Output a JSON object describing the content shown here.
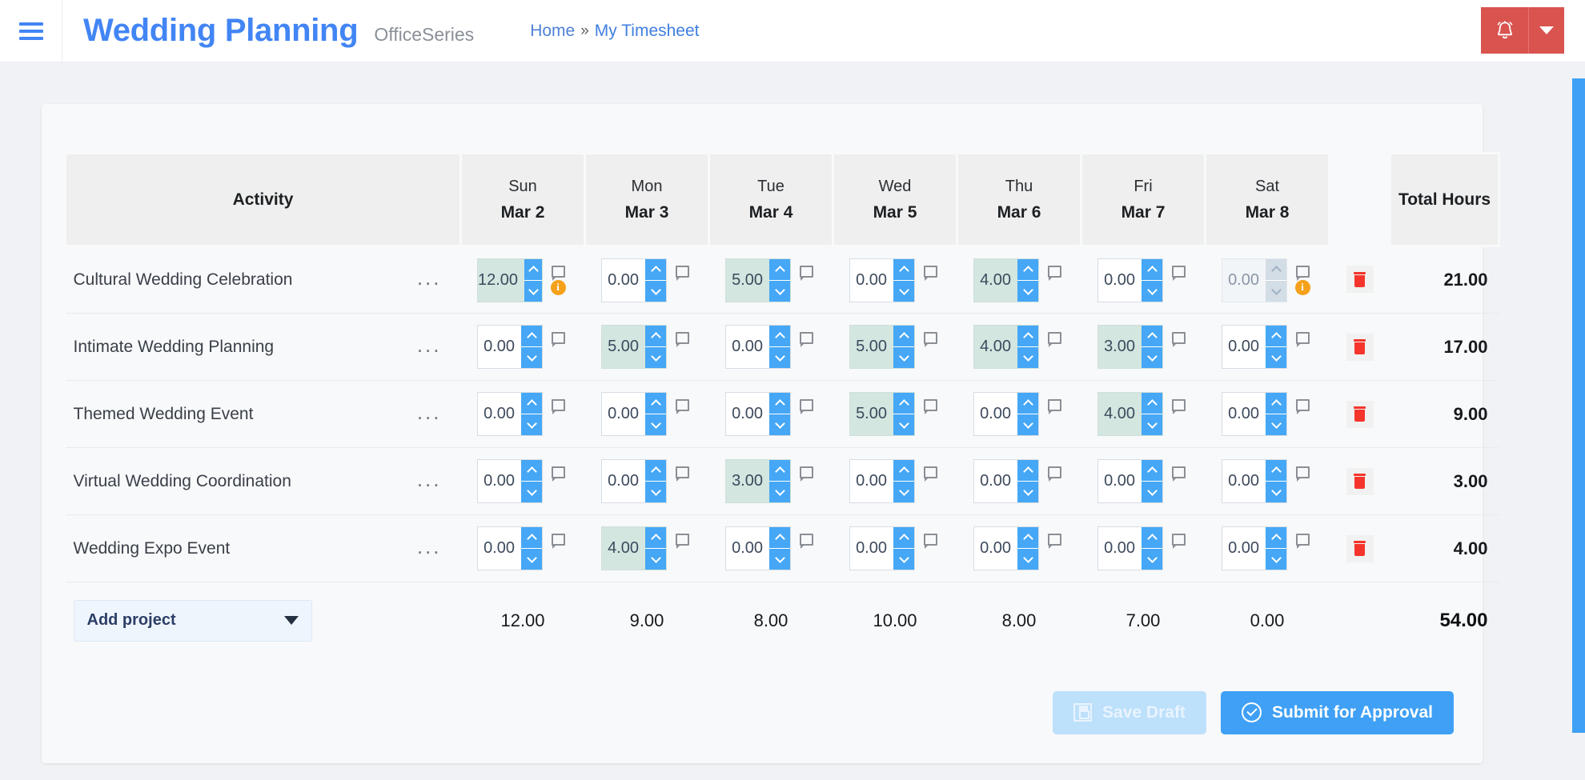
{
  "topbar": {
    "menu_icon": "hamburger-icon",
    "brand_title": "Wedding Planning",
    "brand_subtitle": "OfficeSeries",
    "breadcrumb": {
      "home": "Home",
      "separator": "»",
      "current": "My Timesheet"
    },
    "alert_icon": "bell-icon",
    "alert_caret_icon": "chevron-down-icon",
    "alert_color": "#d9534f"
  },
  "timesheet": {
    "columns": {
      "activity": "Activity",
      "days": [
        {
          "dow": "Sun",
          "date": "Mar 2"
        },
        {
          "dow": "Mon",
          "date": "Mar 3"
        },
        {
          "dow": "Tue",
          "date": "Mar 4"
        },
        {
          "dow": "Wed",
          "date": "Mar 5"
        },
        {
          "dow": "Thu",
          "date": "Mar 6"
        },
        {
          "dow": "Fri",
          "date": "Mar 7"
        },
        {
          "dow": "Sat",
          "date": "Mar 8"
        }
      ],
      "total": "Total Hours"
    },
    "row_menu_label": "...",
    "rows": [
      {
        "activity": "Cultural Wedding Celebration",
        "hours": [
          "12.00",
          "0.00",
          "5.00",
          "0.00",
          "4.00",
          "0.00",
          "0.00"
        ],
        "filled": [
          true,
          false,
          true,
          false,
          true,
          false,
          false
        ],
        "disabled": [
          false,
          false,
          false,
          false,
          false,
          false,
          true
        ],
        "info": [
          true,
          false,
          false,
          false,
          false,
          false,
          true
        ],
        "total": "21.00"
      },
      {
        "activity": "Intimate Wedding Planning",
        "hours": [
          "0.00",
          "5.00",
          "0.00",
          "5.00",
          "4.00",
          "3.00",
          "0.00"
        ],
        "filled": [
          false,
          true,
          false,
          true,
          true,
          true,
          false
        ],
        "disabled": [
          false,
          false,
          false,
          false,
          false,
          false,
          false
        ],
        "info": [
          false,
          false,
          false,
          false,
          false,
          false,
          false
        ],
        "total": "17.00"
      },
      {
        "activity": "Themed Wedding Event",
        "hours": [
          "0.00",
          "0.00",
          "0.00",
          "5.00",
          "0.00",
          "4.00",
          "0.00"
        ],
        "filled": [
          false,
          false,
          false,
          true,
          false,
          true,
          false
        ],
        "disabled": [
          false,
          false,
          false,
          false,
          false,
          false,
          false
        ],
        "info": [
          false,
          false,
          false,
          false,
          false,
          false,
          false
        ],
        "total": "9.00"
      },
      {
        "activity": "Virtual Wedding Coordination",
        "hours": [
          "0.00",
          "0.00",
          "3.00",
          "0.00",
          "0.00",
          "0.00",
          "0.00"
        ],
        "filled": [
          false,
          false,
          true,
          false,
          false,
          false,
          false
        ],
        "disabled": [
          false,
          false,
          false,
          false,
          false,
          false,
          false
        ],
        "info": [
          false,
          false,
          false,
          false,
          false,
          false,
          false
        ],
        "total": "3.00"
      },
      {
        "activity": "Wedding Expo Event",
        "hours": [
          "0.00",
          "4.00",
          "0.00",
          "0.00",
          "0.00",
          "0.00",
          "0.00"
        ],
        "filled": [
          false,
          true,
          false,
          false,
          false,
          false,
          false
        ],
        "disabled": [
          false,
          false,
          false,
          false,
          false,
          false,
          false
        ],
        "info": [
          false,
          false,
          false,
          false,
          false,
          false,
          false
        ],
        "total": "4.00"
      }
    ],
    "add_project_label": "Add project",
    "day_totals": [
      "12.00",
      "9.00",
      "8.00",
      "10.00",
      "8.00",
      "7.00",
      "0.00"
    ],
    "grand_total": "54.00",
    "filled_cell_color": "#d3e6e0",
    "spinner_color": "#45a7f5",
    "delete_icon": "trash-icon",
    "note_icon": "comment-icon",
    "info_icon": "info-badge-icon"
  },
  "actions": {
    "save_draft": "Save Draft",
    "save_draft_icon": "floppy-disk-icon",
    "save_draft_disabled": true,
    "submit": "Submit for Approval",
    "submit_icon": "check-circle-icon",
    "submit_color": "#3fa0f5"
  }
}
